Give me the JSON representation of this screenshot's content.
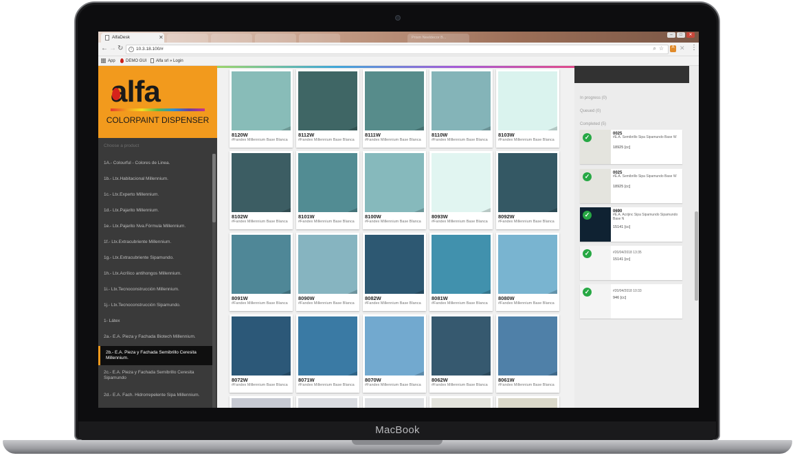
{
  "device": {
    "brand": "MacBook"
  },
  "browser": {
    "tab_title": "AlfaDesk",
    "ghost_tabs": [
      "",
      "",
      "",
      "",
      "Prism Neeldecor B..."
    ],
    "url": "10.3.18.100/#",
    "bookmarks": [
      {
        "label": "App",
        "icon": "apps-grid-icon"
      },
      {
        "label": "DEMO GUI",
        "icon": "drop-icon"
      },
      {
        "label": "Alfa srl » Login",
        "icon": "document-icon"
      }
    ]
  },
  "sidebar": {
    "logo_word": "alfa",
    "logo_subtitle": "COLORPAINT DISPENSER",
    "choose_label": "Choose a product",
    "products": [
      "1A.- Colourful - Colores de Linea.",
      "1b.- Ltx.Habitacional Millennium.",
      "1c.- Ltx.Experto Millennium.",
      "1d.- Ltx.Pajarito Millennium.",
      "1e.- Ltx.Pajarito Nva.Fórmula Millennium.",
      "1f.- Ltx.Extracubriente Millennium.",
      "1g.- Ltx.Extracubriente Sipamundo.",
      "1h.- Ltx.Acrílico antihongos Millennium.",
      "1i.- Ltx.Tecnoconstrucción Millennium.",
      "1j.- Ltx.Tecnoconstrucción Sipamundo.",
      "1- Látex",
      "2a.- E.A. Pieza y Fachada Biotech Millennium.",
      "2b.- E.A. Pieza y Fachada Semibrillo Ceresita Millennium.",
      "2c.- E.A. Pieza y Fachada Semibrillo Ceresita Sipamundo",
      "2d.- E.A. Fach. Hidrorrepelente Sipa Millennium."
    ],
    "selected_index": 12
  },
  "colors": {
    "card_desc": "#Fandex Millennium Base Blanca",
    "rows": [
      [
        {
          "code": "8120W",
          "hex": "#88bcb8"
        },
        {
          "code": "8112W",
          "hex": "#3f6665"
        },
        {
          "code": "8111W",
          "hex": "#578c8b"
        },
        {
          "code": "8110W",
          "hex": "#84b4b8"
        },
        {
          "code": "8103W",
          "hex": "#daf3ee"
        }
      ],
      [
        {
          "code": "8102W",
          "hex": "#3c5d63"
        },
        {
          "code": "8101W",
          "hex": "#528c93"
        },
        {
          "code": "8100W",
          "hex": "#86b9bc"
        },
        {
          "code": "8093W",
          "hex": "#e1f5f1"
        },
        {
          "code": "8092W",
          "hex": "#345864"
        }
      ],
      [
        {
          "code": "8091W",
          "hex": "#4f8797"
        },
        {
          "code": "8090W",
          "hex": "#86b4c0"
        },
        {
          "code": "8082W",
          "hex": "#2d5872"
        },
        {
          "code": "8081W",
          "hex": "#4191ad"
        },
        {
          "code": "8080W",
          "hex": "#79b4d0"
        }
      ],
      [
        {
          "code": "8072W",
          "hex": "#2c5878"
        },
        {
          "code": "8071W",
          "hex": "#3a7aa4"
        },
        {
          "code": "8070W",
          "hex": "#72a9cf"
        },
        {
          "code": "8062W",
          "hex": "#36596f"
        },
        {
          "code": "8061W",
          "hex": "#4f80a8"
        }
      ],
      [
        {
          "code": "",
          "hex": "#c6c9d2"
        },
        {
          "code": "",
          "hex": "#d9dbe0"
        },
        {
          "code": "",
          "hex": "#dfe1e4"
        },
        {
          "code": "",
          "hex": "#e3e3dc"
        },
        {
          "code": "",
          "hex": "#dad8c9"
        }
      ]
    ]
  },
  "queue": {
    "in_progress": "In progress (0)",
    "queued": "Queued (0)",
    "completed": "Completed (5)",
    "jobs": [
      {
        "code": "0025",
        "desc": "#E.A. Semibrillo Sipa Sipamundo Base W",
        "qty": "18925 [cc]",
        "swatch": "#e4e4de",
        "status": "done"
      },
      {
        "code": "0025",
        "desc": "#E.A. Semibrillo Sipa Sipamundo Base W",
        "qty": "18925 [cc]",
        "swatch": "#e4e4de",
        "status": "done"
      },
      {
        "code": "0690",
        "desc": "#E.A. Acrijinc Sipa Sipamundo Sipamundo Base N",
        "qty": "15141 [cc]",
        "swatch": "#0f2232",
        "status": "done"
      },
      {
        "code": "",
        "desc": "#20/04/2018 13:35",
        "qty": "15141 [cc]",
        "swatch": "#f4f4f4",
        "status": "done"
      },
      {
        "code": "",
        "desc": "#20/04/2018 10:33",
        "qty": "946 [cc]",
        "swatch": "#f4f4f4",
        "status": "done"
      }
    ]
  }
}
